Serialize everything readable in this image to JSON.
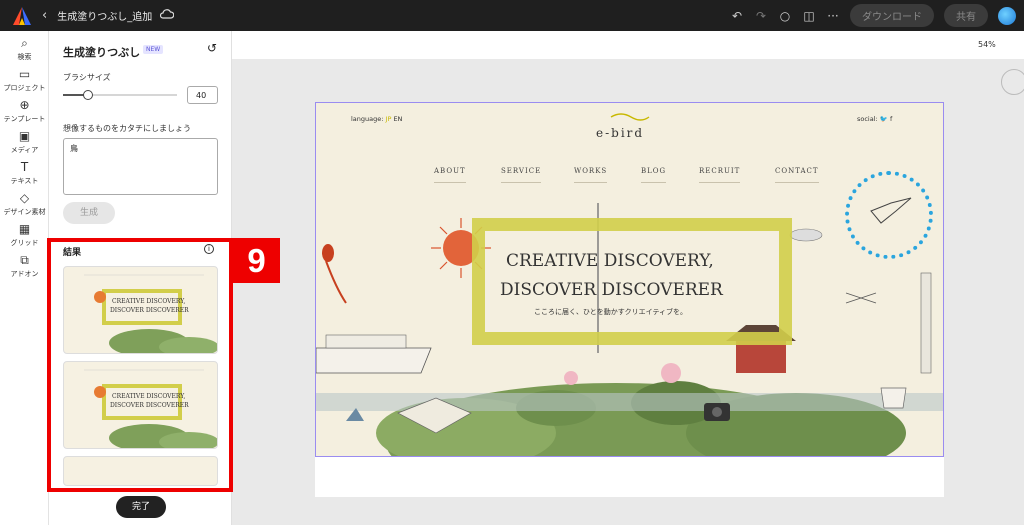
{
  "topbar": {
    "doc_title": "生成塗りつぶし_追加",
    "download_label": "ダウンロード",
    "share_label": "共有"
  },
  "rail": [
    {
      "label": "検索",
      "icon": "search-icon"
    },
    {
      "label": "プロジェクト",
      "icon": "folder-icon"
    },
    {
      "label": "テンプレート",
      "icon": "template-icon"
    },
    {
      "label": "メディア",
      "icon": "media-icon"
    },
    {
      "label": "テキスト",
      "icon": "text-icon"
    },
    {
      "label": "デザイン素材",
      "icon": "shapes-icon"
    },
    {
      "label": "グリッド",
      "icon": "grid-icon"
    },
    {
      "label": "アドオン",
      "icon": "addon-icon"
    }
  ],
  "panel": {
    "title": "生成塗りつぶし",
    "badge": "NEW",
    "brush_label": "ブラシサイズ",
    "brush_value": "40",
    "brush_fraction": 0.22,
    "prompt_label": "想像するものをカタチにしましょう",
    "prompt_value": "鳥",
    "generate_label": "生成",
    "results_label": "結果",
    "done_label": "完了"
  },
  "annotation": {
    "number": "9",
    "color": "#e00000"
  },
  "zoom": "54%",
  "artboard": {
    "language_label": "language:",
    "lang_jp": "JP",
    "lang_en": "EN",
    "social_label": "social:",
    "logo_text": "e-bird",
    "nav": [
      "ABOUT",
      "SERVICE",
      "WORKS",
      "BLOG",
      "RECRUIT",
      "CONTACT"
    ],
    "hero_line1": "CREATIVE DISCOVERY,",
    "hero_line2": "DISCOVER DISCOVERER",
    "hero_sub": "こころに届く、ひとを動かすクリエイティブを。",
    "accent_color": "#d2ce4a",
    "selection_color": "#2aa5de"
  },
  "thumbs": [
    {
      "line1": "CREATIVE DISCOVERY,",
      "line2": "DISCOVER DISCOVERER"
    },
    {
      "line1": "CREATIVE DISCOVERY,",
      "line2": "DISCOVER DISCOVERER"
    }
  ]
}
